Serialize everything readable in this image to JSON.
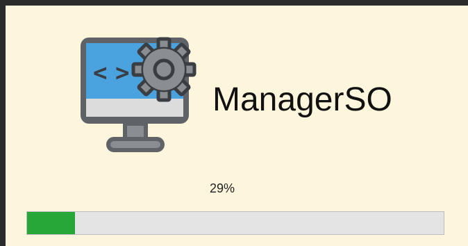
{
  "app": {
    "name": "ManagerSO",
    "logo_icon": "monitor-code-gear-icon"
  },
  "progress": {
    "label": "29%",
    "fraction": 0.115,
    "fill_color": "#27a737",
    "track_color": "#e4e4e4"
  }
}
